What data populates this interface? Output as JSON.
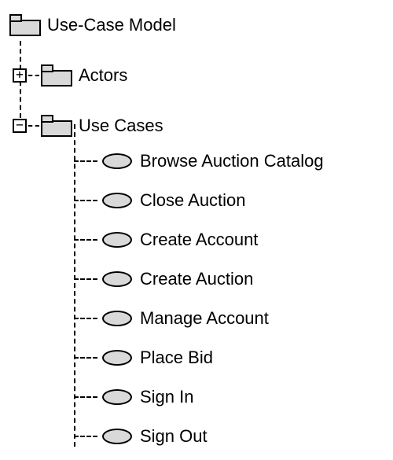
{
  "root": {
    "label": "Use-Case Model"
  },
  "nodes": {
    "actors": {
      "label": "Actors",
      "expander": "+"
    },
    "usecases": {
      "label": "Use Cases",
      "expander": "−"
    }
  },
  "usecase_items": [
    {
      "label": "Browse Auction Catalog"
    },
    {
      "label": "Close Auction"
    },
    {
      "label": "Create Account"
    },
    {
      "label": "Create Auction"
    },
    {
      "label": "Manage Account"
    },
    {
      "label": "Place Bid"
    },
    {
      "label": "Sign In"
    },
    {
      "label": "Sign Out"
    }
  ]
}
